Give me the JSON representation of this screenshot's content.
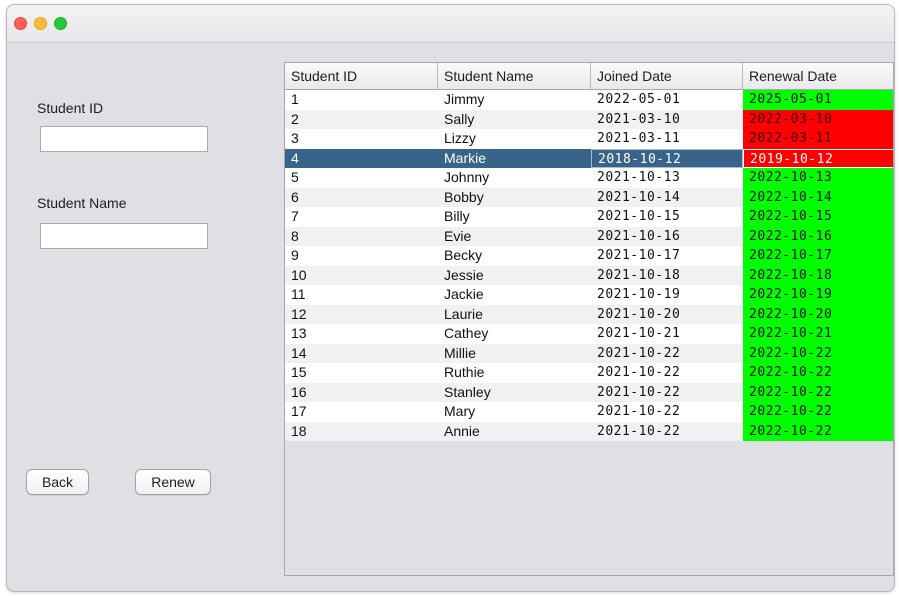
{
  "window": {
    "traffic_lights": [
      "close",
      "minimize",
      "maximize"
    ]
  },
  "form": {
    "student_id_label": "Student ID",
    "student_id_value": "",
    "student_name_label": "Student Name",
    "student_name_value": "",
    "back_label": "Back",
    "renew_label": "Renew"
  },
  "table": {
    "headers": [
      "Student ID",
      "Student Name",
      "Joined Date",
      "Renewal Date"
    ],
    "selected_row": 3,
    "colors": {
      "active": "#00ff00",
      "expired": "#ff0000",
      "selection": "#376488"
    },
    "rows": [
      {
        "id": "1",
        "name": "Jimmy",
        "joined": "2022-05-01",
        "renewal": "2025-05-01",
        "status": "active"
      },
      {
        "id": "2",
        "name": "Sally",
        "joined": "2021-03-10",
        "renewal": "2022-03-10",
        "status": "expired"
      },
      {
        "id": "3",
        "name": "Lizzy",
        "joined": "2021-03-11",
        "renewal": "2022-03-11",
        "status": "expired"
      },
      {
        "id": "4",
        "name": "Markie",
        "joined": "2018-10-12",
        "renewal": "2019-10-12",
        "status": "expired"
      },
      {
        "id": "5",
        "name": "Johnny",
        "joined": "2021-10-13",
        "renewal": "2022-10-13",
        "status": "active"
      },
      {
        "id": "6",
        "name": "Bobby",
        "joined": "2021-10-14",
        "renewal": "2022-10-14",
        "status": "active"
      },
      {
        "id": "7",
        "name": "Billy",
        "joined": "2021-10-15",
        "renewal": "2022-10-15",
        "status": "active"
      },
      {
        "id": "8",
        "name": "Evie",
        "joined": "2021-10-16",
        "renewal": "2022-10-16",
        "status": "active"
      },
      {
        "id": "9",
        "name": "Becky",
        "joined": "2021-10-17",
        "renewal": "2022-10-17",
        "status": "active"
      },
      {
        "id": "10",
        "name": "Jessie",
        "joined": "2021-10-18",
        "renewal": "2022-10-18",
        "status": "active"
      },
      {
        "id": "11",
        "name": "Jackie",
        "joined": "2021-10-19",
        "renewal": "2022-10-19",
        "status": "active"
      },
      {
        "id": "12",
        "name": "Laurie",
        "joined": "2021-10-20",
        "renewal": "2022-10-20",
        "status": "active"
      },
      {
        "id": "13",
        "name": "Cathey",
        "joined": "2021-10-21",
        "renewal": "2022-10-21",
        "status": "active"
      },
      {
        "id": "14",
        "name": "Millie",
        "joined": "2021-10-22",
        "renewal": "2022-10-22",
        "status": "active"
      },
      {
        "id": "15",
        "name": "Ruthie",
        "joined": "2021-10-22",
        "renewal": "2022-10-22",
        "status": "active"
      },
      {
        "id": "16",
        "name": "Stanley",
        "joined": "2021-10-22",
        "renewal": "2022-10-22",
        "status": "active"
      },
      {
        "id": "17",
        "name": "Mary",
        "joined": "2021-10-22",
        "renewal": "2022-10-22",
        "status": "active"
      },
      {
        "id": "18",
        "name": "Annie",
        "joined": "2021-10-22",
        "renewal": "2022-10-22",
        "status": "active"
      }
    ]
  }
}
